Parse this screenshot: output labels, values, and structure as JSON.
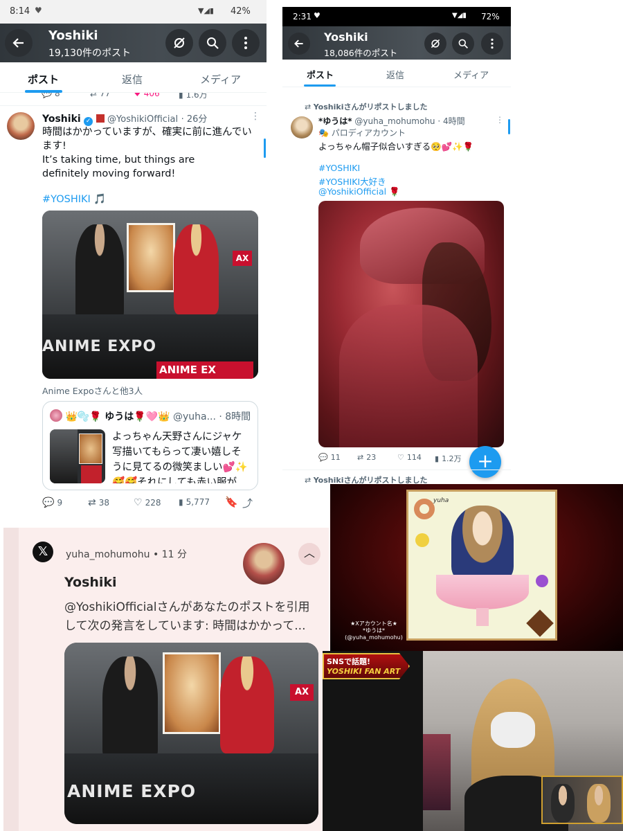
{
  "left_phone": {
    "status_time": "8:14",
    "status_battery": "42%",
    "header_title": "Yoshiki",
    "header_subtitle": "19,130件のポスト",
    "tabs": [
      "ポスト",
      "返信",
      "メディア"
    ],
    "prev_stats": {
      "replies": "8",
      "reposts": "77",
      "likes": "406",
      "views": "1.6万"
    },
    "tweet": {
      "name": "Yoshiki",
      "handle": "@YoshikiOfficial",
      "time": "· 26分",
      "text_jp": "時間はかかっていますが、確実に前に進んでいます!",
      "text_en": "It’s taking time, but things are definitely moving forward!",
      "hashtag": "#YOSHIKI 🎵",
      "tagged": "Anime Expoさんと他3人",
      "quote": {
        "emojis": "👑🫧🌹",
        "name": "ゆうは🌹🩷👑",
        "handle": "@yuha...",
        "time": "· 8時間",
        "text": "よっちゃん天野さんにジャケ写描いてもらって凄い嬉しそうに見てるの微笑ましい💕✨🥰🥰それにしても赤い服が..."
      },
      "stats": {
        "replies": "9",
        "reposts": "38",
        "likes": "228",
        "views": "5,777"
      }
    },
    "photo_text": {
      "expo": "ANIME EXPO",
      "ax": "AX",
      "expo2": "ANIME EX"
    }
  },
  "right_phone": {
    "status_time": "2:31",
    "status_battery": "72%",
    "header_title": "Yoshiki",
    "header_subtitle": "18,086件のポスト",
    "tabs": [
      "ポスト",
      "返信",
      "メディア"
    ],
    "repost_label": "Yoshikiさんがリポストしました",
    "tweet": {
      "name": "*ゆうは*",
      "handle": "@yuha_mohumohu",
      "time": "· 4時間",
      "parody": "パロディアカウント",
      "text": "よっちゃん帽子似合いすぎる🥺💕✨🌹",
      "tags": [
        "#YOSHIKI",
        "#YOSHIKI大好き",
        "@YoshikiOfficial 🌹"
      ]
    },
    "stats": {
      "replies": "11",
      "reposts": "23",
      "likes": "114",
      "views": "1.2万"
    },
    "repost_label2": "Yoshikiさんがリポストしました",
    "fab_label": "+"
  },
  "notification": {
    "handle": "yuha_mohumohu",
    "time": "• 11 分",
    "title": "Yoshiki",
    "body": "@YoshikiOfficialさんがあなたのポストを引用して次の発言をしています: 時間はかかって...",
    "photo_text": {
      "expo": "ANIME EXPO",
      "ax": "AX"
    }
  },
  "tv": {
    "caption_label": "★Xアカウント名★",
    "caption_name": "*ゆうは*",
    "caption_handle": "(@yuha_mohumohu)",
    "banner_line1": "SNSで話題!",
    "banner_line2": "YOSHIKI FAN ART",
    "art_sign": "yuha"
  },
  "colors": {
    "accent": "#1d9bf0",
    "like": "#f91880",
    "header": "#2b2f33"
  }
}
